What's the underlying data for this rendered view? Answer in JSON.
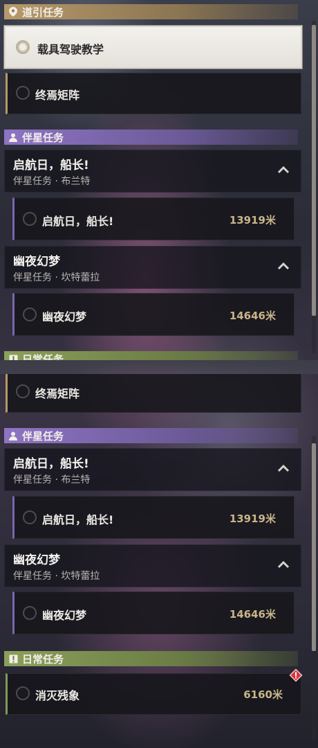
{
  "top": {
    "guide_header": "道引任务",
    "tracked_quest": "载具驾驶教学",
    "quest_zhongyan": "终焉矩阵",
    "companion_header": "伴星任务",
    "companions": [
      {
        "title": "启航日，船长!",
        "subtitle": "伴星任务 · 布兰特",
        "quest": "启航日，船长!",
        "distance": "13919米"
      },
      {
        "title": "幽夜幻梦",
        "subtitle": "伴星任务 · 坎特蕾拉",
        "quest": "幽夜幻梦",
        "distance": "14646米"
      }
    ],
    "daily_header": "日常任务"
  },
  "bottom": {
    "quest_zhongyan": "终焉矩阵",
    "companion_header": "伴星任务",
    "companions": [
      {
        "title": "启航日，船长!",
        "subtitle": "伴星任务 · 布兰特",
        "quest": "启航日，船长!",
        "distance": "13919米"
      },
      {
        "title": "幽夜幻梦",
        "subtitle": "伴星任务 · 坎特蕾拉",
        "quest": "幽夜幻梦",
        "distance": "14646米"
      }
    ],
    "daily_header": "日常任务",
    "daily_quest": "消灭残象",
    "daily_distance": "6160米"
  },
  "icons": {
    "guide": "map-pin-icon",
    "companion": "person-icon",
    "daily": "exclamation-box-icon",
    "collapse": "chevron-up-icon",
    "alert": "alert-diamond-icon"
  },
  "colors": {
    "guide_accent": "#b49a64",
    "companion_accent": "#7a66b0",
    "daily_accent": "#7f9a56",
    "distance": "#c8b58a",
    "alert": "#d8343f"
  }
}
